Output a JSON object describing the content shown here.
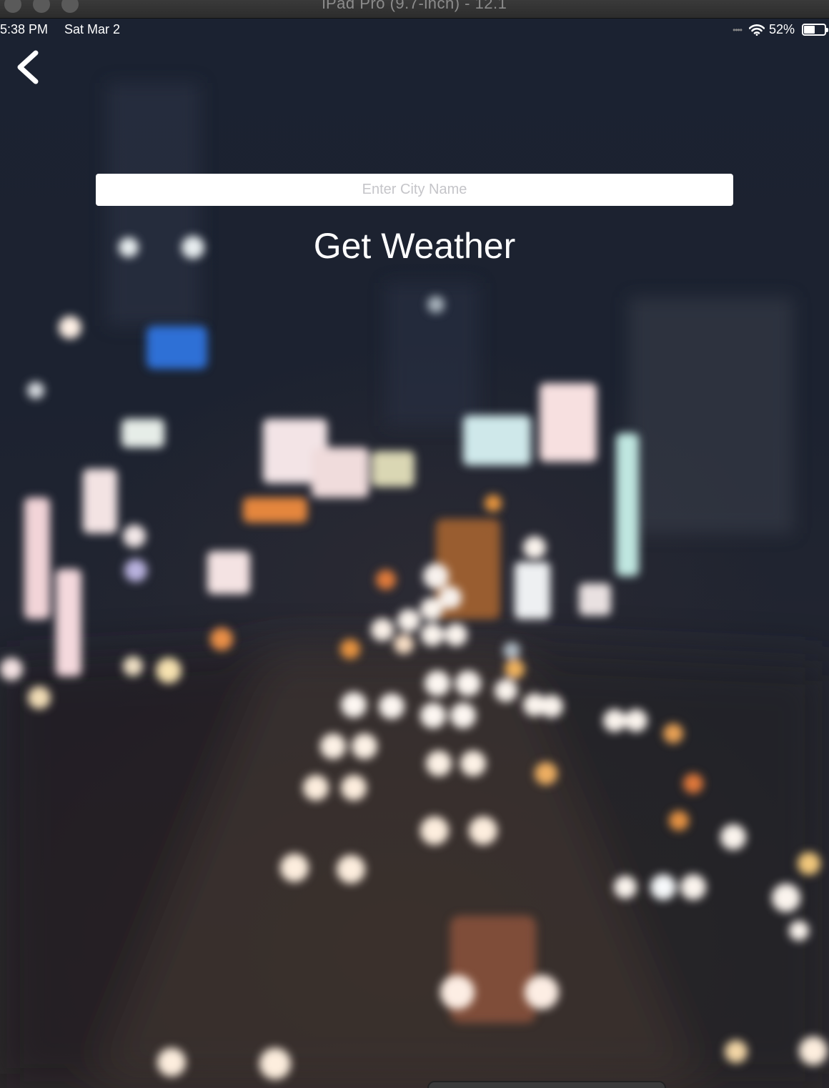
{
  "window": {
    "title": "iPad Pro (9.7-inch) - 12.1"
  },
  "status_bar": {
    "time": "5:38 PM",
    "date": "Sat Mar 2",
    "battery_percent": "52%",
    "battery_level": 0.52,
    "icons": [
      "signal-dots-icon",
      "wifi-icon",
      "battery-icon"
    ]
  },
  "nav": {
    "back_icon": "chevron-left-icon"
  },
  "form": {
    "city_value": "",
    "city_placeholder": "Enter City Name",
    "get_weather_label": "Get Weather"
  },
  "colors": {
    "text": "#ffffff",
    "input_background": "#ffffff",
    "placeholder": "#c5c5c9",
    "background": "#1c2230"
  }
}
